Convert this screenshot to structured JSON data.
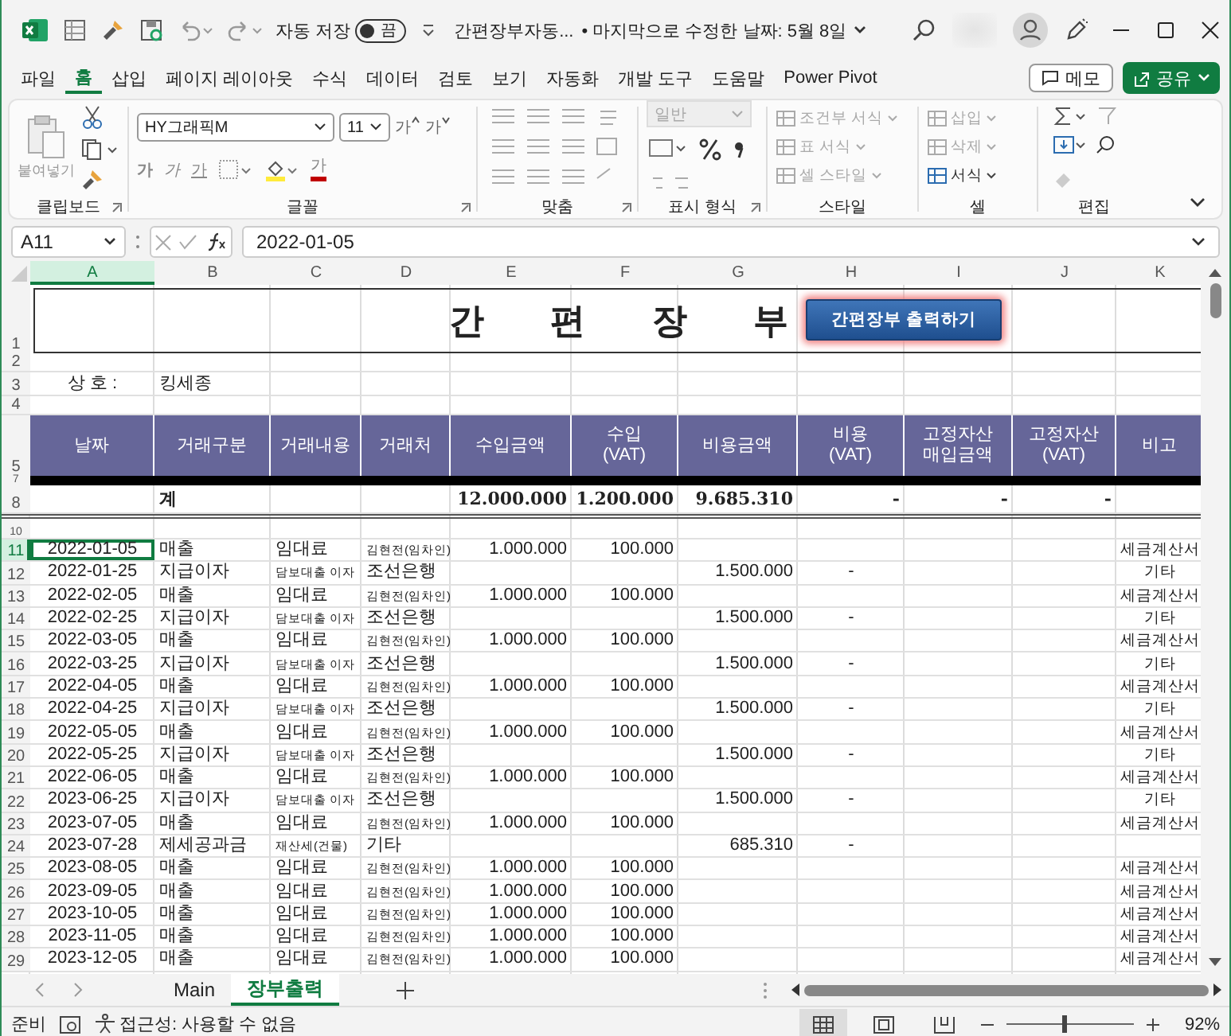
{
  "title_bar": {
    "autosave_label": "자동 저장",
    "autosave_toggle": {
      "label": "끔",
      "on": false
    },
    "document_title": "간편장부자동...",
    "saved_info": "• 마지막으로 수정한 날짜: 5월 8일"
  },
  "ribbon_tabs": [
    {
      "label": "파일",
      "selected": false
    },
    {
      "label": "홈",
      "selected": true
    },
    {
      "label": "삽입",
      "selected": false
    },
    {
      "label": "페이지 레이아웃",
      "selected": false
    },
    {
      "label": "수식",
      "selected": false
    },
    {
      "label": "데이터",
      "selected": false
    },
    {
      "label": "검토",
      "selected": false
    },
    {
      "label": "보기",
      "selected": false
    },
    {
      "label": "자동화",
      "selected": false
    },
    {
      "label": "개발 도구",
      "selected": false
    },
    {
      "label": "도움말",
      "selected": false
    },
    {
      "label": "Power Pivot",
      "selected": false
    }
  ],
  "memo_button": "메모",
  "share_button": "공유",
  "ribbon": {
    "groups": [
      {
        "kind": "clipboard",
        "label": "클립보드",
        "launcher": true,
        "paste_label": "붙여넣기"
      },
      {
        "kind": "font",
        "label": "글꼴",
        "launcher": true,
        "font_name": "HY그래픽M",
        "font_size": "11",
        "size_buttons": [
          {
            "label": "가",
            "kind": "grow"
          },
          {
            "label": "가",
            "kind": "shrink"
          }
        ],
        "style_buttons": [
          {
            "label": "가",
            "kind": "bold"
          },
          {
            "label": "가",
            "kind": "italic"
          },
          {
            "label": "가",
            "kind": "underline"
          },
          {
            "label": "가",
            "kind": "color"
          }
        ]
      },
      {
        "kind": "alignment",
        "label": "맞춤",
        "launcher": true
      },
      {
        "kind": "number",
        "label": "표시 형식",
        "launcher": true,
        "format": {
          "value": "일반",
          "disabled": true
        }
      },
      {
        "kind": "commands",
        "label": "스타일",
        "launcher": false,
        "commands": [
          {
            "label": "조건부 서식",
            "disabled": true
          },
          {
            "label": "표 서식",
            "disabled": true
          },
          {
            "label": "셀 스타일",
            "disabled": true
          }
        ]
      },
      {
        "kind": "commands",
        "label": "셀",
        "launcher": false,
        "commands": [
          {
            "label": "삽입",
            "disabled": true
          },
          {
            "label": "삭제",
            "disabled": true
          },
          {
            "label": "서식",
            "disabled": false
          }
        ]
      },
      {
        "kind": "editing",
        "label": "편집",
        "launcher": false
      }
    ]
  },
  "formula_bar": {
    "name_box": "A11",
    "formula": "2022-01-05"
  },
  "columns": [
    {
      "label": "A",
      "selected": true
    },
    {
      "label": "B",
      "selected": false
    },
    {
      "label": "C",
      "selected": false
    },
    {
      "label": "D",
      "selected": false
    },
    {
      "label": "E",
      "selected": false
    },
    {
      "label": "F",
      "selected": false
    },
    {
      "label": "G",
      "selected": false
    },
    {
      "label": "H",
      "selected": false
    },
    {
      "label": "I",
      "selected": false
    },
    {
      "label": "J",
      "selected": false
    },
    {
      "label": "K",
      "selected": false
    }
  ],
  "sheet": {
    "row_labels": [
      "1",
      "2",
      "3",
      "4",
      "5",
      "7",
      "8",
      "10"
    ],
    "title": "간 편 장 부",
    "print_button": "간편장부 출력하기",
    "business": {
      "label": "상 호 :",
      "value": "킹세종"
    },
    "header": [
      "날짜",
      "거래구분",
      "거래내용",
      "거래처",
      "수입금액",
      "수입\n(VAT)",
      "비용금액",
      "비용\n(VAT)",
      "고정자산\n매입금액",
      "고정자산\n(VAT)",
      "비고"
    ],
    "total": {
      "type": "계",
      "income": "12.000.000",
      "income_vat": "1.200.000",
      "expense": "9.685.310",
      "expense_vat": "-",
      "asset": "-",
      "asset_vat": "-"
    },
    "rows": [
      {
        "row": "11",
        "kind": "income",
        "active": true,
        "date": "2022-01-05",
        "type": "매출",
        "description": "임대료",
        "party": "김현전(임차인)",
        "income": "1.000.000",
        "income_vat": "100.000",
        "note": "세금계산서"
      },
      {
        "row": "12",
        "kind": "expense",
        "active": false,
        "date": "2022-01-25",
        "type": "지급이자",
        "description": "담보대출 이자",
        "party": "조선은행",
        "expense": "1.500.000",
        "expense_vat": "-",
        "note": "기타"
      },
      {
        "row": "13",
        "kind": "income",
        "active": false,
        "date": "2022-02-05",
        "type": "매출",
        "description": "임대료",
        "party": "김현전(임차인)",
        "income": "1.000.000",
        "income_vat": "100.000",
        "note": "세금계산서"
      },
      {
        "row": "14",
        "kind": "expense",
        "active": false,
        "date": "2022-02-25",
        "type": "지급이자",
        "description": "담보대출 이자",
        "party": "조선은행",
        "expense": "1.500.000",
        "expense_vat": "-",
        "note": "기타"
      },
      {
        "row": "15",
        "kind": "income",
        "active": false,
        "date": "2022-03-05",
        "type": "매출",
        "description": "임대료",
        "party": "김현전(임차인)",
        "income": "1.000.000",
        "income_vat": "100.000",
        "note": "세금계산서"
      },
      {
        "row": "16",
        "kind": "expense",
        "active": false,
        "date": "2022-03-25",
        "type": "지급이자",
        "description": "담보대출 이자",
        "party": "조선은행",
        "expense": "1.500.000",
        "expense_vat": "-",
        "note": "기타"
      },
      {
        "row": "17",
        "kind": "income",
        "active": false,
        "date": "2022-04-05",
        "type": "매출",
        "description": "임대료",
        "party": "김현전(임차인)",
        "income": "1.000.000",
        "income_vat": "100.000",
        "note": "세금계산서"
      },
      {
        "row": "18",
        "kind": "expense",
        "active": false,
        "date": "2022-04-25",
        "type": "지급이자",
        "description": "담보대출 이자",
        "party": "조선은행",
        "expense": "1.500.000",
        "expense_vat": "-",
        "note": "기타"
      },
      {
        "row": "19",
        "kind": "income",
        "active": false,
        "date": "2022-05-05",
        "type": "매출",
        "description": "임대료",
        "party": "김현전(임차인)",
        "income": "1.000.000",
        "income_vat": "100.000",
        "note": "세금계산서"
      },
      {
        "row": "20",
        "kind": "expense",
        "active": false,
        "date": "2022-05-25",
        "type": "지급이자",
        "description": "담보대출 이자",
        "party": "조선은행",
        "expense": "1.500.000",
        "expense_vat": "-",
        "note": "기타"
      },
      {
        "row": "21",
        "kind": "income",
        "active": false,
        "date": "2022-06-05",
        "type": "매출",
        "description": "임대료",
        "party": "김현전(임차인)",
        "income": "1.000.000",
        "income_vat": "100.000",
        "note": "세금계산서"
      },
      {
        "row": "22",
        "kind": "expense",
        "active": false,
        "date": "2023-06-25",
        "type": "지급이자",
        "description": "담보대출 이자",
        "party": "조선은행",
        "expense": "1.500.000",
        "expense_vat": "-",
        "note": "기타"
      },
      {
        "row": "23",
        "kind": "income",
        "active": false,
        "date": "2023-07-05",
        "type": "매출",
        "description": "임대료",
        "party": "김현전(임차인)",
        "income": "1.000.000",
        "income_vat": "100.000",
        "note": "세금계산서"
      },
      {
        "row": "24",
        "kind": "expense",
        "active": false,
        "date": "2023-07-28",
        "type": "제세공과금",
        "description": "재산세(건물)",
        "party": "기타",
        "expense": "685.310",
        "expense_vat": "-"
      },
      {
        "row": "25",
        "kind": "income",
        "active": false,
        "date": "2023-08-05",
        "type": "매출",
        "description": "임대료",
        "party": "김현전(임차인)",
        "income": "1.000.000",
        "income_vat": "100.000",
        "note": "세금계산서"
      },
      {
        "row": "26",
        "kind": "income",
        "active": false,
        "date": "2023-09-05",
        "type": "매출",
        "description": "임대료",
        "party": "김현전(임차인)",
        "income": "1.000.000",
        "income_vat": "100.000",
        "note": "세금계산서"
      },
      {
        "row": "27",
        "kind": "income",
        "active": false,
        "date": "2023-10-05",
        "type": "매출",
        "description": "임대료",
        "party": "김현전(임차인)",
        "income": "1.000.000",
        "income_vat": "100.000",
        "note": "세금계산서"
      },
      {
        "row": "28",
        "kind": "income",
        "active": false,
        "date": "2023-11-05",
        "type": "매출",
        "description": "임대료",
        "party": "김현전(임차인)",
        "income": "1.000.000",
        "income_vat": "100.000",
        "note": "세금계산서"
      },
      {
        "row": "29",
        "kind": "income",
        "active": false,
        "date": "2023-12-05",
        "type": "매출",
        "description": "임대료",
        "party": "김현전(임차인)",
        "income": "1.000.000",
        "income_vat": "100.000",
        "note": "세금계산서"
      }
    ]
  },
  "sheet_tabs": [
    {
      "label": "Main",
      "selected": false
    },
    {
      "label": "장부출력",
      "selected": true
    }
  ],
  "status_bar": {
    "status": "준비",
    "accessibility": "접근성: 사용할 수 없음",
    "views": [
      {
        "kind": "normal",
        "selected": true
      },
      {
        "kind": "page_layout",
        "selected": false
      },
      {
        "kind": "page_break",
        "selected": false
      }
    ],
    "zoom": {
      "level": 0.45,
      "reading": "92%"
    }
  }
}
